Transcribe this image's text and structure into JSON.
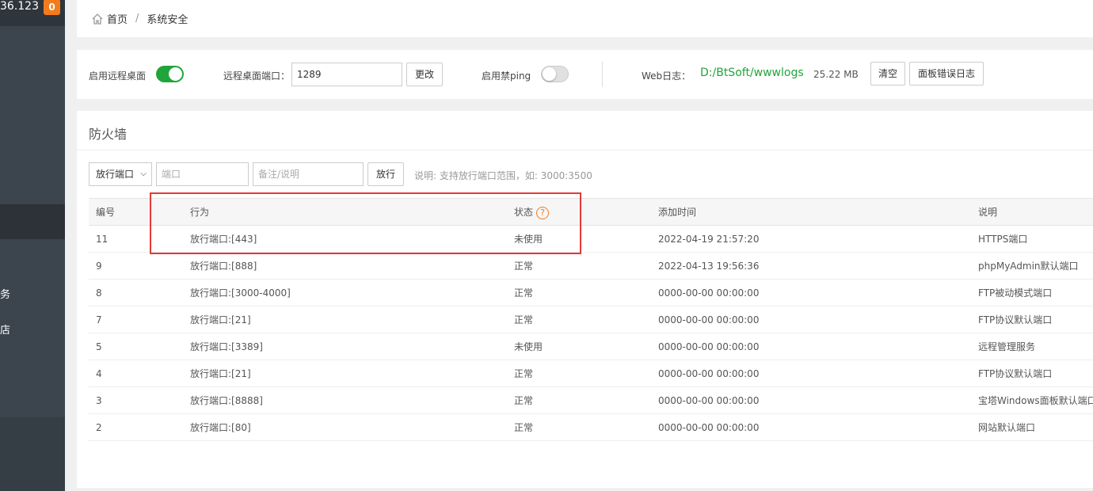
{
  "sidebar": {
    "ip_fragment": "36.123",
    "badge": "0",
    "items": [
      {
        "label": "务"
      },
      {
        "label": "店"
      }
    ]
  },
  "breadcrumb": {
    "home": "首页",
    "separator": "/",
    "current": "系统安全"
  },
  "settings": {
    "remote_desktop_label": "启用远程桌面",
    "remote_desktop_enabled": true,
    "remote_port_label": "远程桌面端口：",
    "remote_port_value": "1289",
    "change_button": "更改",
    "ping_label": "启用禁ping",
    "ping_enabled": false,
    "web_log_label": "Web日志：",
    "web_log_path": "D:/BtSoft/wwwlogs",
    "web_log_size": "25.22 MB",
    "clear_button": "清空",
    "panel_error_log_button": "面板错误日志"
  },
  "firewall": {
    "title": "防火墙",
    "rule_type_selected": "放行端口",
    "port_placeholder": "端口",
    "note_placeholder": "备注/说明",
    "allow_button": "放行",
    "hint": "说明: 支持放行端口范围，如: 3000:3500",
    "columns": [
      "编号",
      "行为",
      "状态",
      "添加时间",
      "说明"
    ],
    "rows": [
      {
        "id": "11",
        "action": "放行端口:[443]",
        "status": "未使用",
        "time": "2022-04-19 21:57:20",
        "note": "HTTPS端口"
      },
      {
        "id": "9",
        "action": "放行端口:[888]",
        "status": "正常",
        "time": "2022-04-13 19:56:36",
        "note": "phpMyAdmin默认端口"
      },
      {
        "id": "8",
        "action": "放行端口:[3000-4000]",
        "status": "正常",
        "time": "0000-00-00 00:00:00",
        "note": "FTP被动模式端口"
      },
      {
        "id": "7",
        "action": "放行端口:[21]",
        "status": "正常",
        "time": "0000-00-00 00:00:00",
        "note": "FTP协议默认端口"
      },
      {
        "id": "5",
        "action": "放行端口:[3389]",
        "status": "未使用",
        "time": "0000-00-00 00:00:00",
        "note": "远程管理服务"
      },
      {
        "id": "4",
        "action": "放行端口:[21]",
        "status": "正常",
        "time": "0000-00-00 00:00:00",
        "note": "FTP协议默认端口"
      },
      {
        "id": "3",
        "action": "放行端口:[8888]",
        "status": "正常",
        "time": "0000-00-00 00:00:00",
        "note": "宝塔Windows面板默认端口"
      },
      {
        "id": "2",
        "action": "放行端口:[80]",
        "status": "正常",
        "time": "0000-00-00 00:00:00",
        "note": "网站默认端口"
      }
    ]
  },
  "colors": {
    "accent_green": "#20a53a",
    "badge_orange": "#f37b1d",
    "highlight_red": "#e53935",
    "sidebar_bg": "#3c444d"
  }
}
